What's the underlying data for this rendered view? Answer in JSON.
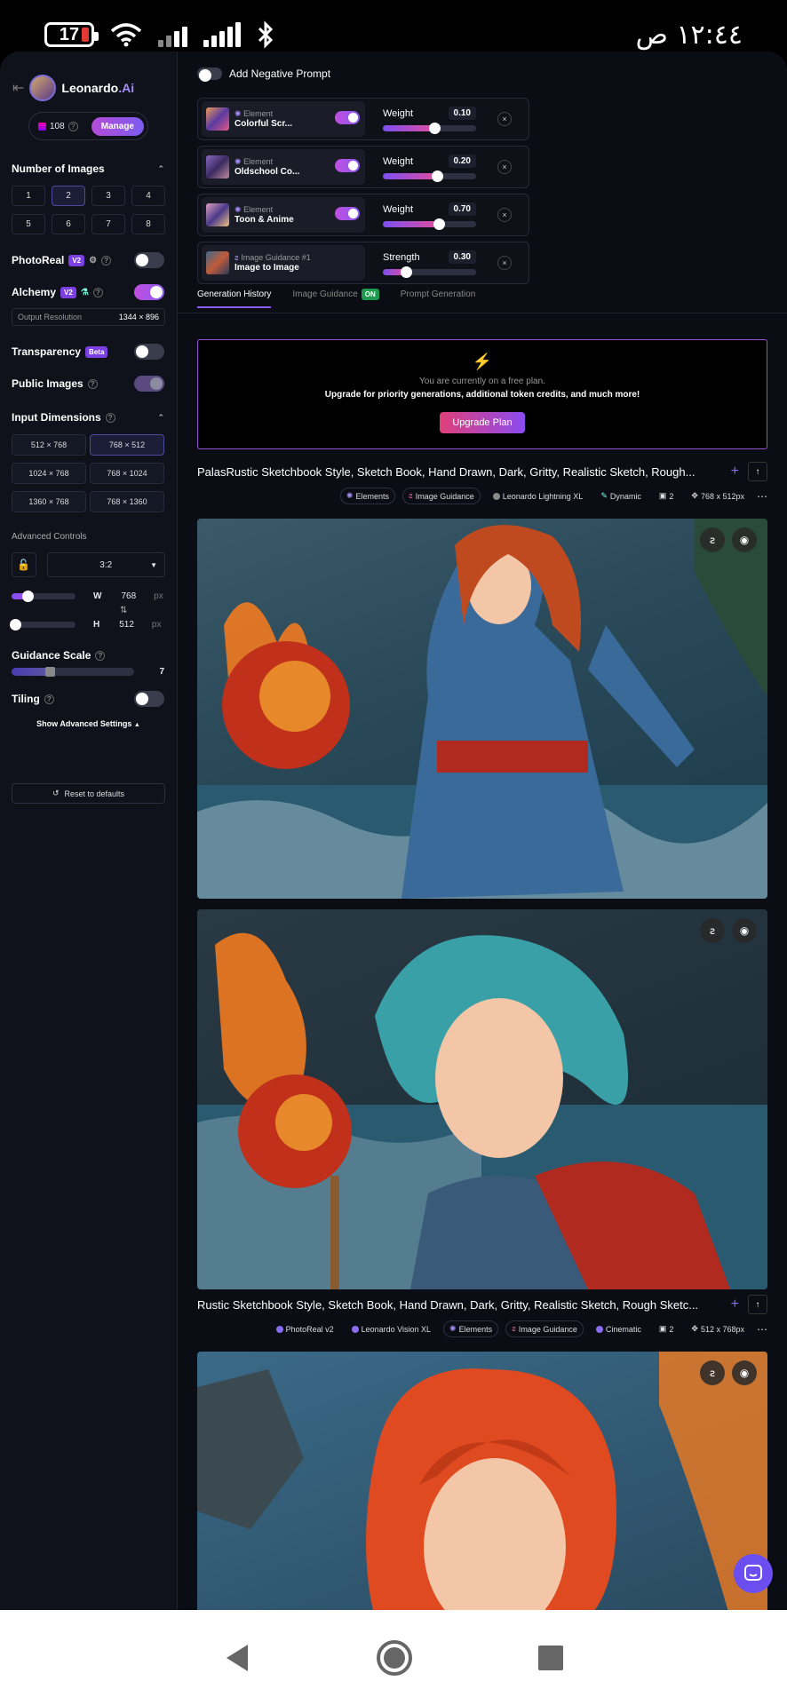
{
  "status_bar": {
    "battery": "17",
    "time": "١٢:٤٤ ص"
  },
  "sidebar": {
    "brand_name": "Leonardo",
    "brand_suffix": ".Ai",
    "tokens": "108",
    "manage_label": "Manage",
    "num_images_title": "Number of Images",
    "num_images": [
      "1",
      "2",
      "3",
      "4",
      "5",
      "6",
      "7",
      "8"
    ],
    "photoreal_label": "PhotoReal",
    "photoreal_badge": "V2",
    "alchemy_label": "Alchemy",
    "alchemy_badge": "V2",
    "output_res_label": "Output Resolution",
    "output_res_value": "1344 × 896",
    "transparency_label": "Transparency",
    "transparency_badge": "Beta",
    "public_images_label": "Public Images",
    "input_dims_title": "Input Dimensions",
    "dims": [
      "512 × 768",
      "768 × 512",
      "1024 × 768",
      "768 × 1024",
      "1360 × 768",
      "768 × 1360"
    ],
    "advanced_controls_label": "Advanced Controls",
    "ratio": "3:2",
    "w_label": "W",
    "w_value": "768",
    "h_label": "H",
    "h_value": "512",
    "unit": "px",
    "guidance_label": "Guidance Scale",
    "guidance_value": "7",
    "tiling_label": "Tiling",
    "show_advanced_label": "Show Advanced Settings",
    "reset_label": "Reset to defaults"
  },
  "main": {
    "negative_prompt_label": "Add Negative Prompt",
    "elements": [
      {
        "type": "Element",
        "name": "Colorful Scr...",
        "slider_label": "Weight",
        "value": "0.10",
        "level": 0.55
      },
      {
        "type": "Element",
        "name": "Oldschool Co...",
        "slider_label": "Weight",
        "value": "0.20",
        "level": 0.58
      },
      {
        "type": "Element",
        "name": "Toon & Anime",
        "slider_label": "Weight",
        "value": "0.70",
        "level": 0.6
      },
      {
        "type": "Image Guidance #1",
        "name": "Image to Image",
        "slider_label": "Strength",
        "value": "0.30",
        "level": 0.25
      }
    ],
    "tabs": {
      "history": "Generation History",
      "guidance": "Image Guidance",
      "guidance_badge": "ON",
      "prompt": "Prompt Generation"
    },
    "upgrade": {
      "line1": "You are currently on a free plan.",
      "line2": "Upgrade for priority generations, additional token credits, and much more!",
      "button": "Upgrade Plan"
    },
    "gen1": {
      "title": "PalasRustic Sketchbook Style, Sketch Book, Hand Drawn, Dark, Gritty, Realistic Sketch, Rough...",
      "tags": [
        "Elements",
        "Image Guidance",
        "Leonardo Lightning XL",
        "Dynamic",
        "2",
        "768 x 512px"
      ]
    },
    "gen2": {
      "title": "Rustic Sketchbook Style, Sketch Book, Hand Drawn, Dark, Gritty, Realistic Sketch, Rough Sketc...",
      "tags": [
        "PhotoReal v2",
        "Leonardo Vision XL",
        "Elements",
        "Image Guidance",
        "Cinematic",
        "2",
        "512 x 768px"
      ]
    }
  }
}
